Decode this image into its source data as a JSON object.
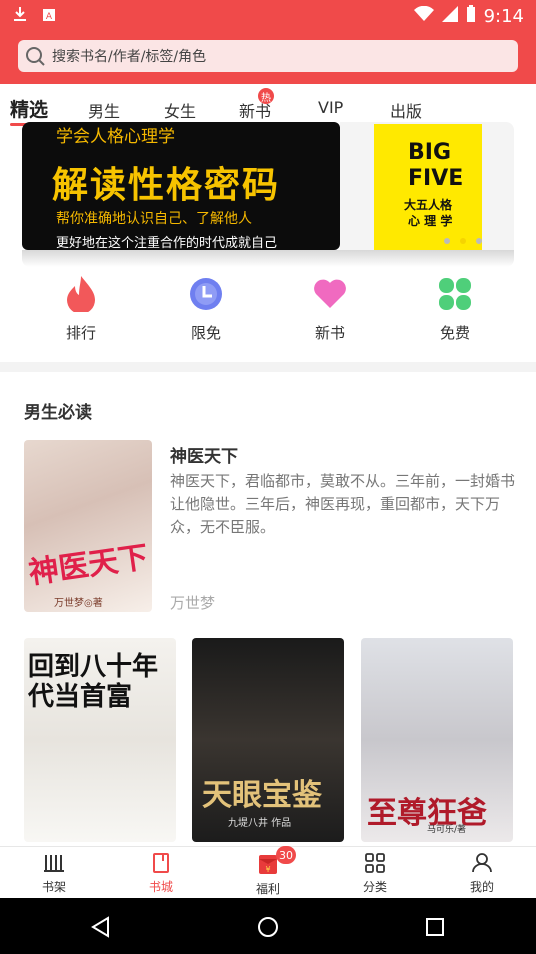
{
  "status_bar": {
    "time": "9:14",
    "icons": [
      "download-icon",
      "app-notification-icon",
      "wifi-icon",
      "signal-icon",
      "battery-icon"
    ]
  },
  "search": {
    "placeholder": "搜索书名/作者/标签/角色"
  },
  "tabs": [
    {
      "label": "精选",
      "active": true
    },
    {
      "label": "男生"
    },
    {
      "label": "女生"
    },
    {
      "label": "新书",
      "badge": "热"
    },
    {
      "label": "VIP"
    },
    {
      "label": "出版"
    }
  ],
  "banner": {
    "subtitle": "学会人格心理学",
    "title": "解读性格密码",
    "line1": "帮你准确地认识自己、了解他人",
    "line2": "更好地在这个注重合作的时代成就自己",
    "side_book": {
      "line1": "BIG",
      "line2": "FIVE",
      "cn1": "大五人格",
      "cn2": "心 理 学"
    }
  },
  "quick_links": [
    {
      "label": "排行",
      "icon": "flame-icon",
      "color": "#f2585a"
    },
    {
      "label": "限免",
      "icon": "clock-icon",
      "color": "#6f7ff0"
    },
    {
      "label": "新书",
      "icon": "heart-icon",
      "color": "#f06ac0"
    },
    {
      "label": "免费",
      "icon": "clover-icon",
      "color": "#4fcf7a"
    }
  ],
  "section": {
    "title": "男生必读",
    "featured": {
      "name": "神医天下",
      "description": "神医天下，君临都市，莫敢不从。三年前，一封婚书让他隐世。三年后，神医再现，重回都市，天下万众，无不臣服。",
      "author": "万世梦",
      "cover_title": "神医天下",
      "cover_author": "万世梦◎著"
    },
    "covers": [
      {
        "title": "回到八十年代当首富"
      },
      {
        "title": "天眼宝鉴",
        "tag": "九堤八井 作品"
      },
      {
        "title": "至尊狂爸",
        "tag": "马可乐/著"
      }
    ]
  },
  "bottom_nav": [
    {
      "label": "书架",
      "icon": "bookshelf-icon"
    },
    {
      "label": "书城",
      "icon": "bookstore-icon",
      "active": true
    },
    {
      "label": "福利",
      "icon": "red-envelope-icon",
      "badge": "30"
    },
    {
      "label": "分类",
      "icon": "category-grid-icon"
    },
    {
      "label": "我的",
      "icon": "profile-icon"
    }
  ],
  "accent_color": "#f04a4a"
}
